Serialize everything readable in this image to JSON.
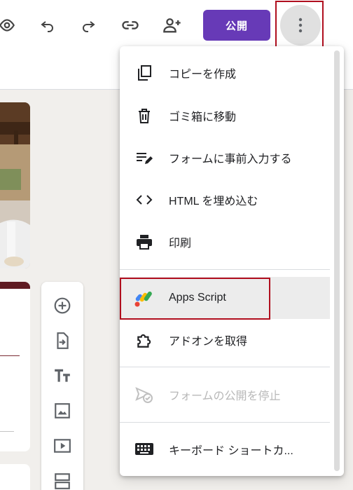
{
  "header": {
    "publish_label": "公開",
    "icons": [
      "preview-eye-icon",
      "undo-icon",
      "redo-icon",
      "link-icon",
      "add-collaborator-icon",
      "more-vert-icon"
    ]
  },
  "menu": {
    "items": [
      {
        "label": "コピーを作成",
        "icon": "copy-icon"
      },
      {
        "label": "ゴミ箱に移動",
        "icon": "trash-icon"
      },
      {
        "label": "フォームに事前入力する",
        "icon": "prefill-icon"
      },
      {
        "label": "HTML を埋め込む",
        "icon": "code-icon"
      },
      {
        "label": "印刷",
        "icon": "print-icon"
      },
      {
        "label": "Apps Script",
        "icon": "apps-script-icon"
      },
      {
        "label": "アドオンを取得",
        "icon": "puzzle-icon"
      },
      {
        "label": "フォームの公開を停止",
        "icon": "unpublish-icon",
        "disabled": true
      },
      {
        "label": "キーボード ショートカ...",
        "icon": "keyboard-icon"
      }
    ]
  },
  "side_toolbar": {
    "icons": [
      "add-question-icon",
      "import-questions-icon",
      "add-title-icon",
      "add-image-icon",
      "add-video-icon",
      "add-section-icon"
    ]
  },
  "colors": {
    "publish": "#673ab7",
    "highlight": "#b00e1e",
    "accent": "#5f1b22"
  }
}
